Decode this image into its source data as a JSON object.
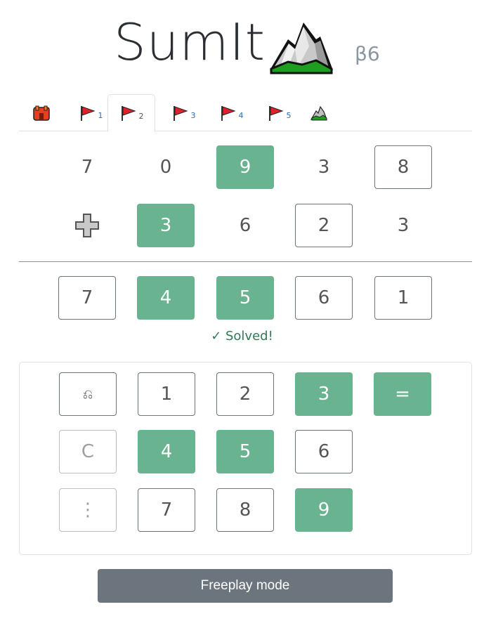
{
  "header": {
    "title": "SumIt",
    "version": "β6",
    "logo_icon": "mountain-icon"
  },
  "tabs": [
    {
      "icon": "castle-icon",
      "label": "",
      "active": false
    },
    {
      "icon": "red-flag-icon",
      "label": "1",
      "active": false
    },
    {
      "icon": "red-flag-icon",
      "label": "2",
      "active": true
    },
    {
      "icon": "red-flag-icon",
      "label": "3",
      "active": false
    },
    {
      "icon": "red-flag-icon",
      "label": "4",
      "active": false
    },
    {
      "icon": "red-flag-icon",
      "label": "5",
      "active": false
    },
    {
      "icon": "mountain-icon",
      "label": "",
      "active": false
    }
  ],
  "puzzle": {
    "row1": [
      "7",
      "0",
      "9",
      "3",
      "8"
    ],
    "row2": [
      "3",
      "6",
      "2",
      "3"
    ],
    "operator_icon": "plus-icon",
    "result": [
      "7",
      "4",
      "5",
      "6",
      "1"
    ]
  },
  "status": "✓ Solved!",
  "keypad": {
    "undo_label": "⎌",
    "keys_row1": [
      "1",
      "2",
      "3"
    ],
    "equals_label": "=",
    "clear_label": "C",
    "keys_row2": [
      "4",
      "5",
      "6"
    ],
    "more_label": "⋮",
    "keys_row3": [
      "7",
      "8",
      "9"
    ]
  },
  "freeplay_label": "Freeplay mode",
  "colors": {
    "accent_green": "#6ab390",
    "button_gray": "#6c757d",
    "solved_green": "#2f7a55",
    "flag_red": "#e0202a"
  }
}
